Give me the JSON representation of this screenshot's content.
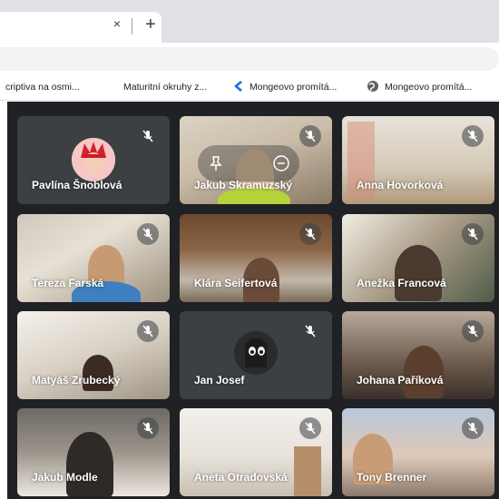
{
  "browser": {
    "tab": {
      "close_symbol": "×"
    },
    "new_tab_symbol": "+",
    "bookmarks": [
      {
        "label": "criptiva na osmi...",
        "icon": "none"
      },
      {
        "label": "Maturitní okruhy z...",
        "icon": "none"
      },
      {
        "label": "Mongeovo promítá...",
        "icon": "bookmark-blue-icon"
      },
      {
        "label": "Mongeovo promítá...",
        "icon": "globe-icon"
      }
    ]
  },
  "meeting": {
    "tiles": [
      {
        "name": "Pavlína Šnoblová",
        "mic": "muted"
      },
      {
        "name": "Jakub Skramuzský",
        "mic": "muted",
        "hover": true
      },
      {
        "name": "Anna Hovorková",
        "mic": "muted"
      },
      {
        "name": "Tereza Farská",
        "mic": "muted"
      },
      {
        "name": "Klára Seifertová",
        "mic": "muted"
      },
      {
        "name": "Anežka Francová",
        "mic": "muted"
      },
      {
        "name": "Matyáš Zrubecký",
        "mic": "muted"
      },
      {
        "name": "Jan Josef",
        "mic": "muted"
      },
      {
        "name": "Johana Paříková",
        "mic": "muted"
      },
      {
        "name": "Jakub Modle",
        "mic": "muted"
      },
      {
        "name": "Aneta Otradovská",
        "mic": "muted"
      },
      {
        "name": "Tony Brenner",
        "mic": "muted"
      }
    ],
    "hover_actions": [
      {
        "icon": "pin-icon"
      },
      {
        "icon": "remove-icon"
      }
    ]
  },
  "colors": {
    "meet_background": "#202124",
    "tile_background": "#3c4043",
    "name_text": "#ffffff"
  }
}
